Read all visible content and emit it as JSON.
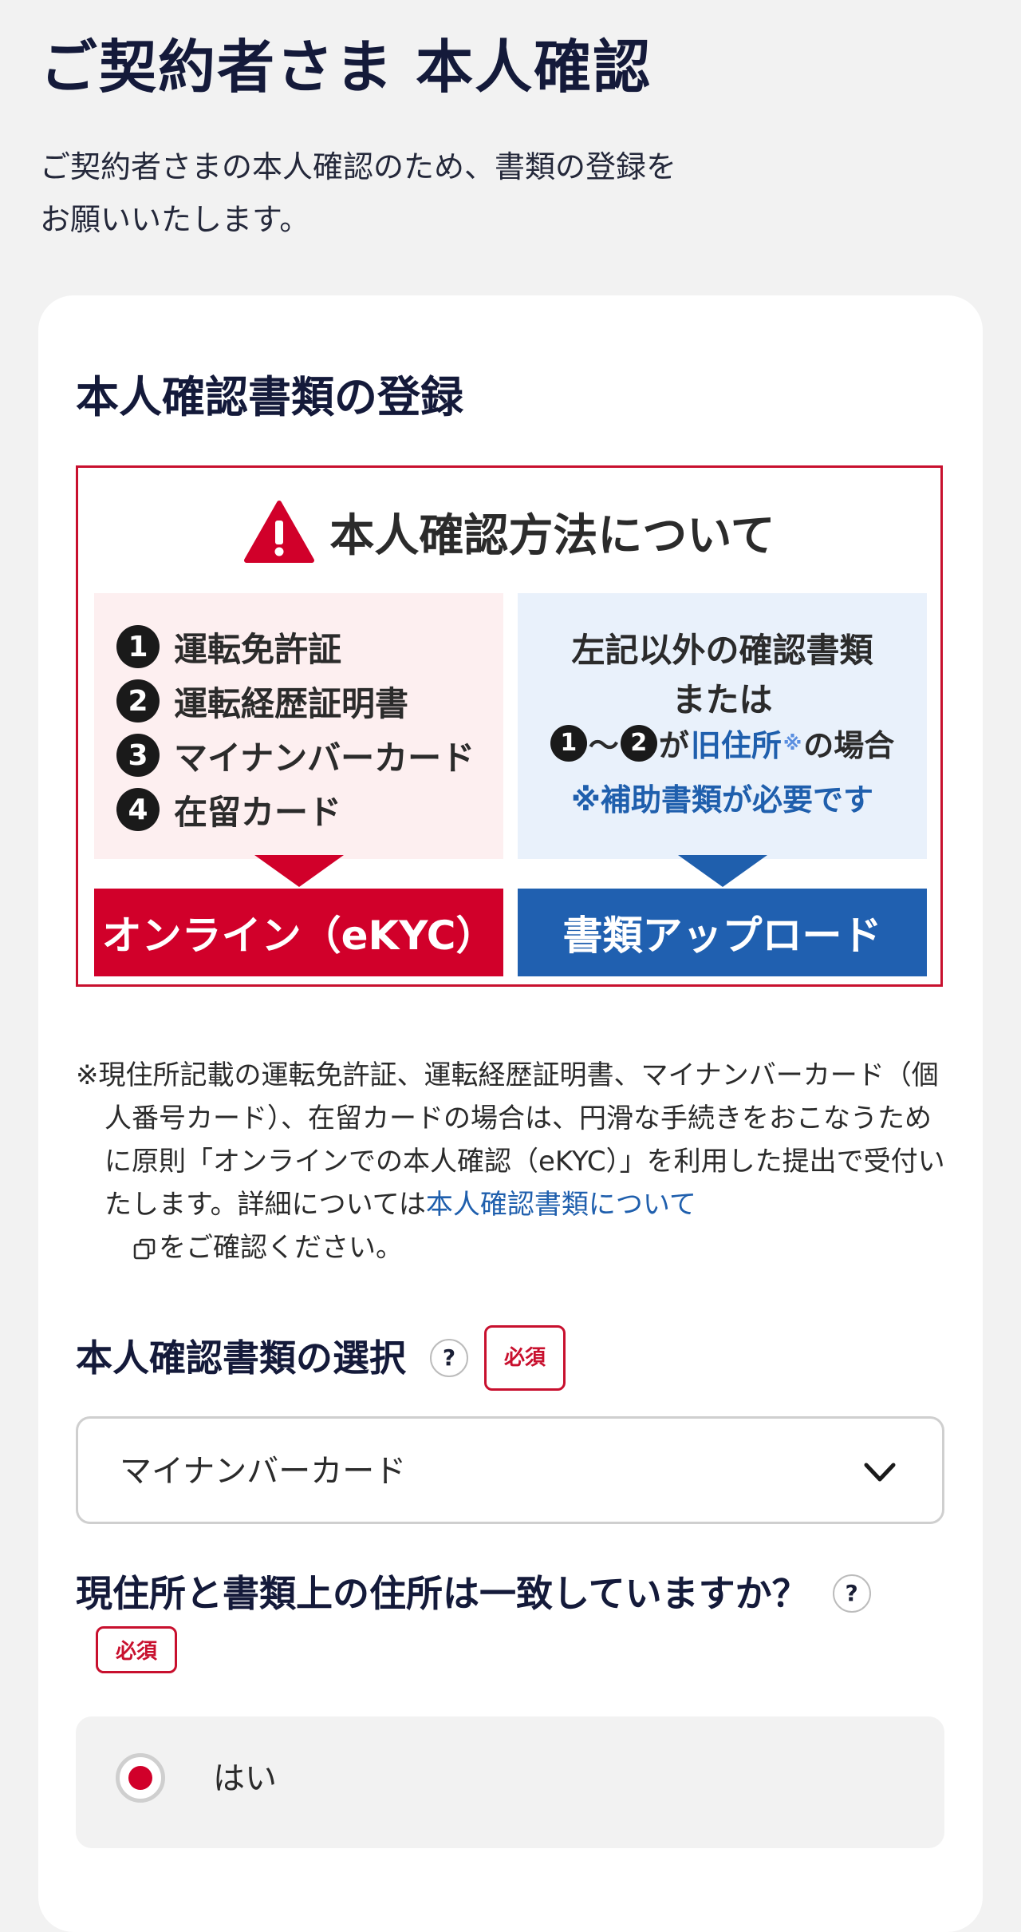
{
  "header": {
    "title": "ご契約者さま 本人確認",
    "description_line1": "ご契約者さまの本人確認のため、書類の登録を",
    "description_line2": "お願いいたします。"
  },
  "section": {
    "title": "本人確認書類の登録"
  },
  "notice": {
    "title": "本人確認方法について",
    "left_items": [
      {
        "num": "1",
        "label": "運転免許証"
      },
      {
        "num": "2",
        "label": "運転経歴証明書"
      },
      {
        "num": "3",
        "label": "マイナンバーカード"
      },
      {
        "num": "4",
        "label": "在留カード"
      }
    ],
    "right": {
      "line1": "左記以外の確認書類",
      "line2": "または",
      "num_a": "1",
      "tilde": "～",
      "num_b": "2",
      "ga": "が",
      "old_address": "旧住所",
      "mark": "※",
      "case_suffix": "の場合",
      "supplement": "※補助書類が必要です"
    },
    "online_button": "オンライン（eKYC）",
    "upload_button": "書類アップロード",
    "colors": {
      "red": "#d1002a",
      "blue": "#2060b0"
    }
  },
  "note": {
    "text": "※現住所記載の運転免許証、運転経歴証明書、マイナンバーカード（個人番号カード）、在留カードの場合は、円滑な手続きをおこなうために原則「オンラインでの本人確認（eKYC）」を利用した提出で受付いたします。詳細については",
    "link": "本人確認書類について",
    "link_icon": "external-window-icon",
    "suffix": "をご確認ください。"
  },
  "document_select": {
    "label": "本人確認書類の選択",
    "help": "?",
    "required": "必須",
    "value": "マイナンバーカード",
    "icon": "chevron-down-icon"
  },
  "address_question": {
    "label": "現住所と書類上の住所は一致していますか？",
    "help": "?",
    "required": "必須",
    "options": [
      {
        "label": "はい",
        "selected": true
      }
    ]
  }
}
